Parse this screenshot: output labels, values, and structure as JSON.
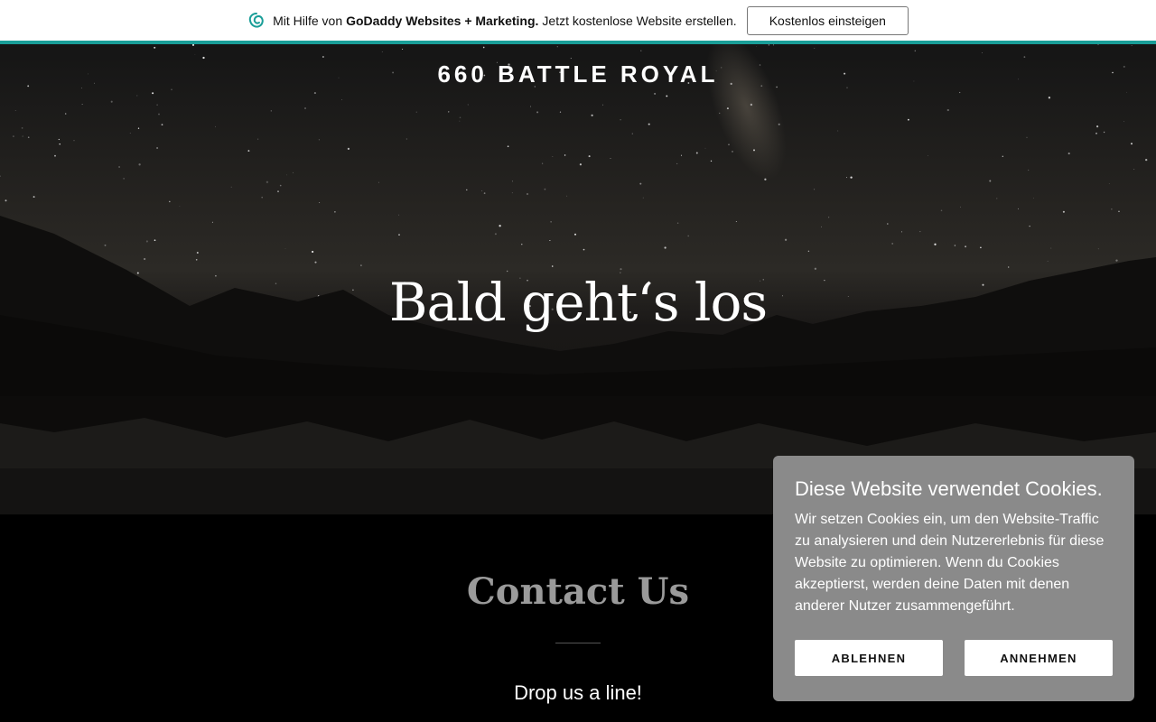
{
  "promo": {
    "prefix": "Mit Hilfe von",
    "brand": "GoDaddy Websites + Marketing.",
    "suffix": "Jetzt kostenlose Website erstellen.",
    "cta_label": "Kostenlos einsteigen",
    "logo_icon": "godaddy-logo-icon",
    "accent_color": "#1a9e98"
  },
  "hero": {
    "site_title": "660 BATTLE ROYAL",
    "headline": "Bald geht‘s los"
  },
  "contact": {
    "title": "Contact Us",
    "subtitle": "Drop us a line!"
  },
  "cookie": {
    "title": "Diese Website verwendet Cookies.",
    "body_lines": [
      "Wir setzen Cookies ein, um den Website-Traffic",
      "zu analysieren und dein Nutzererlebnis für diese",
      "Website zu optimieren. Wenn du Cookies",
      "akzeptierst, werden deine Daten mit denen",
      "anderer Nutzer zusammengeführt."
    ],
    "decline_label": "ABLEHNEN",
    "accept_label": "ANNEHMEN"
  }
}
